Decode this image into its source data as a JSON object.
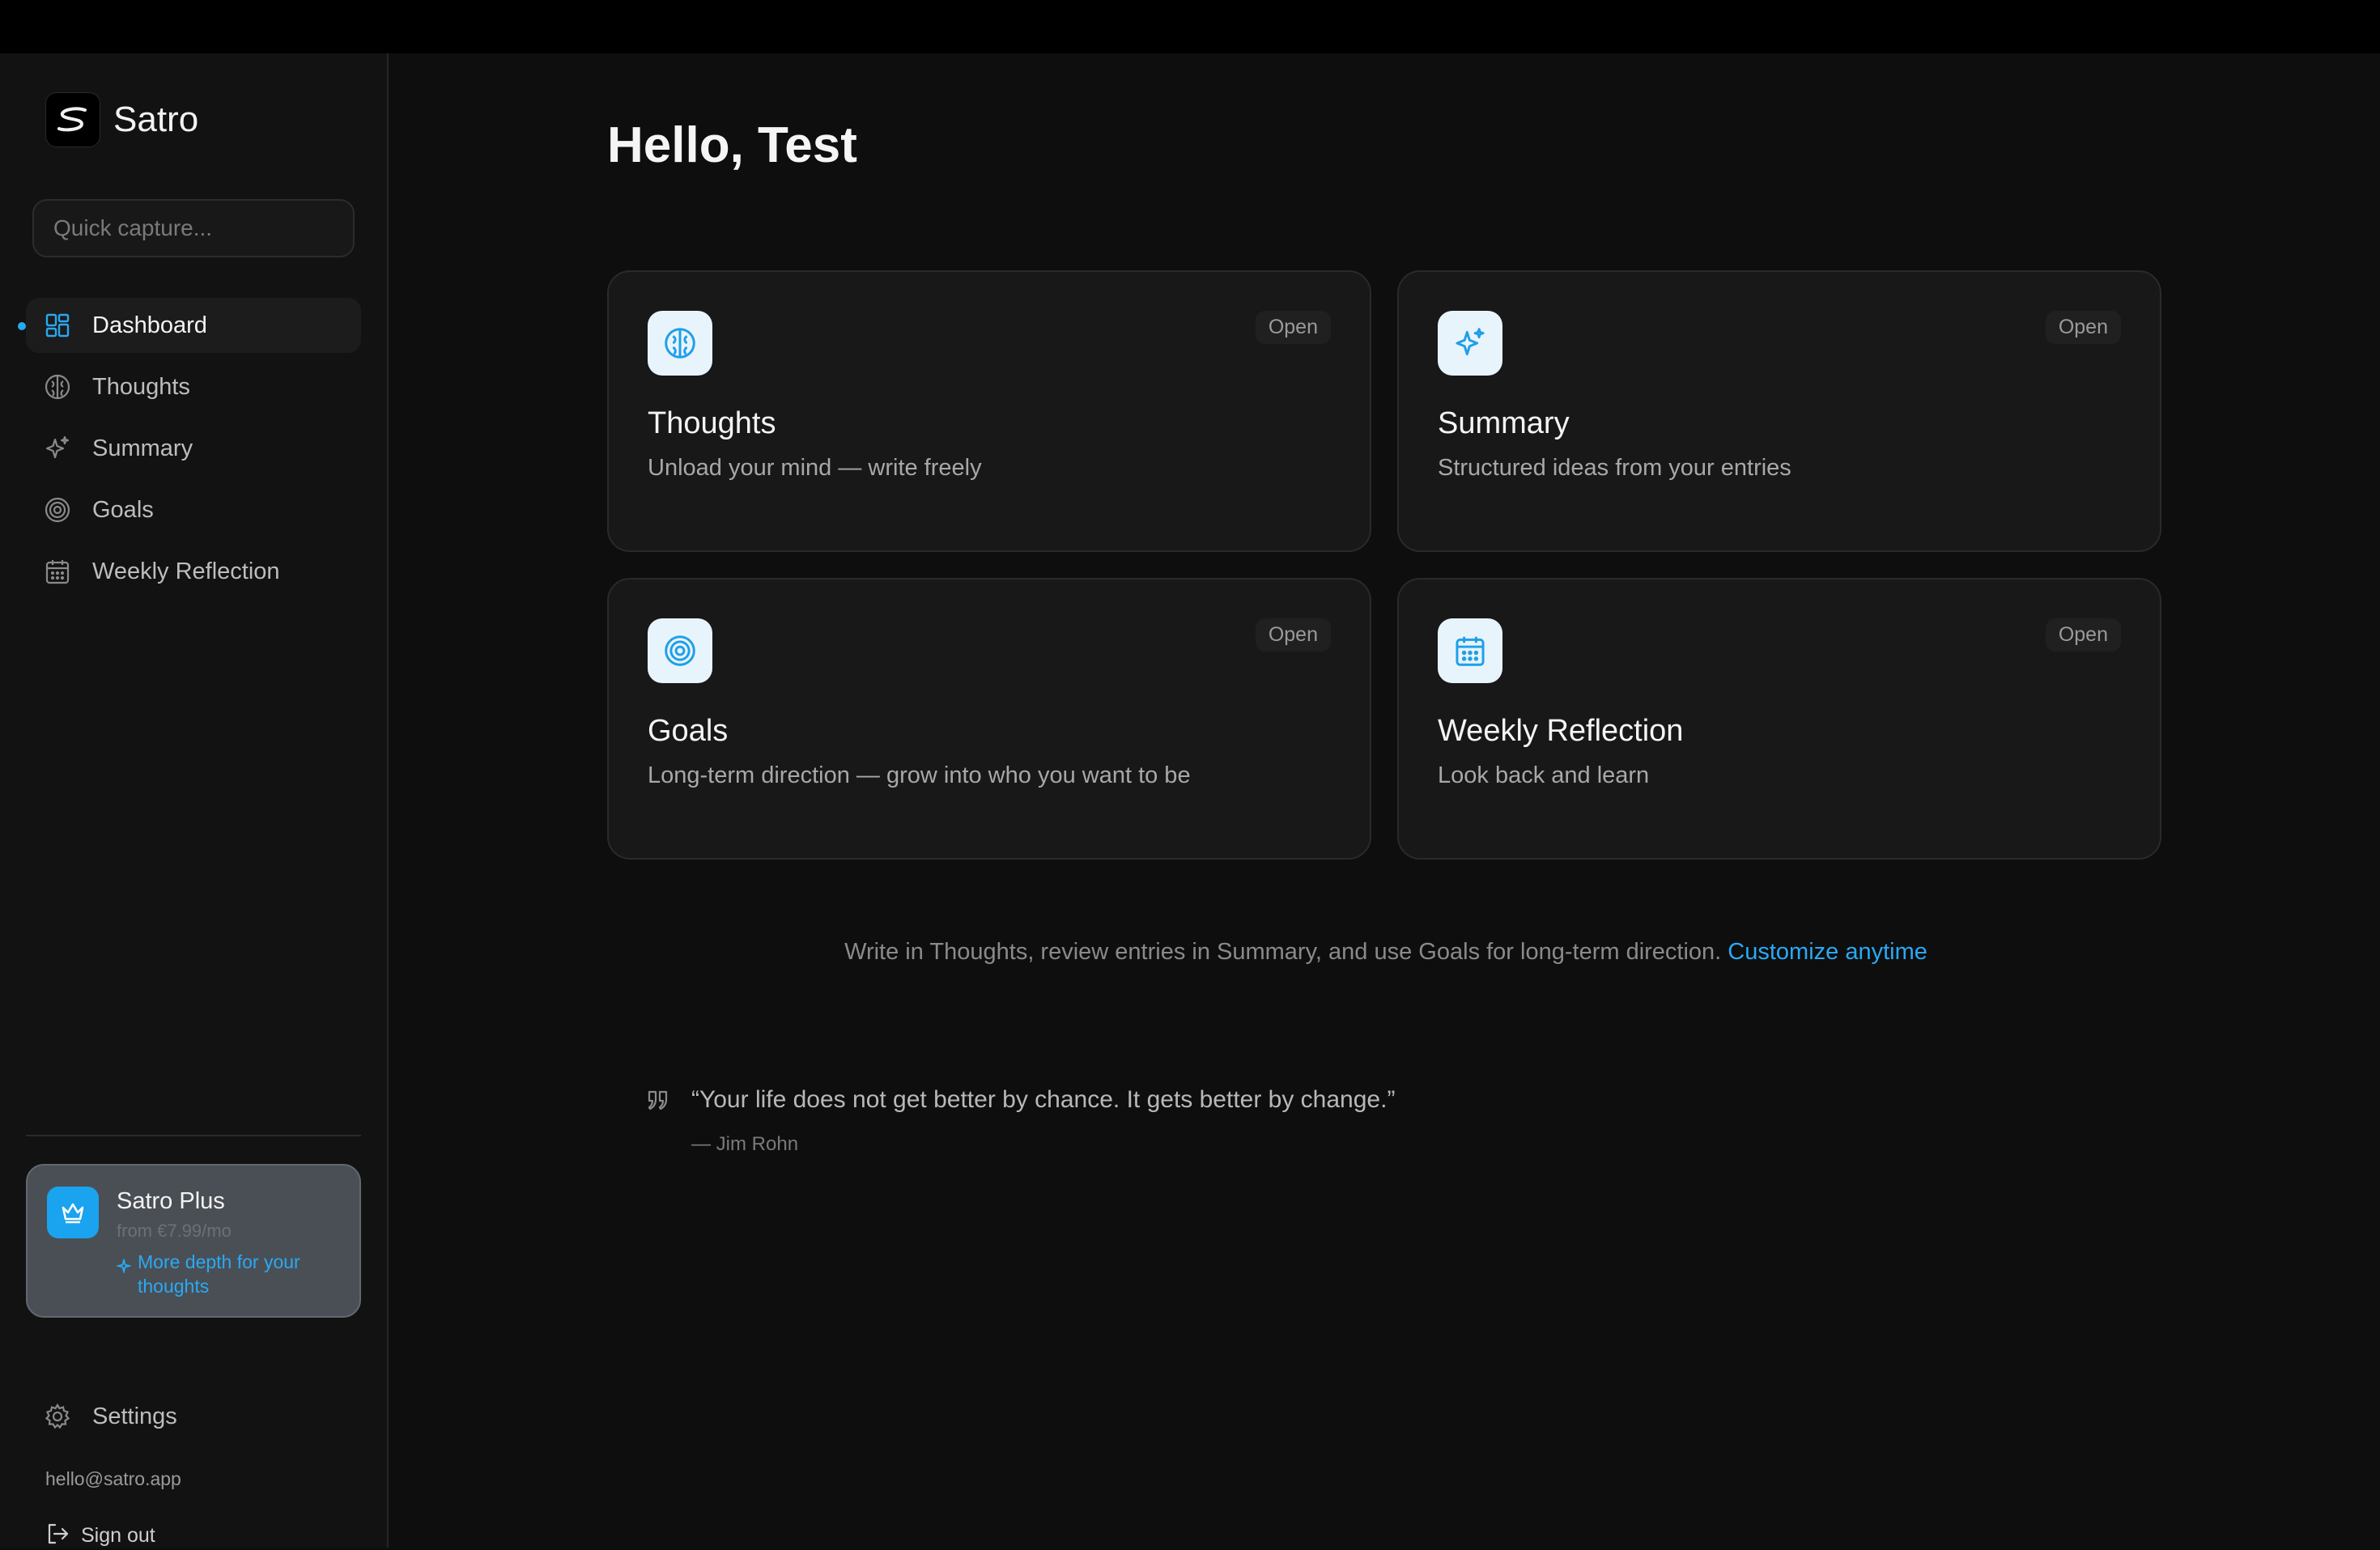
{
  "app": {
    "name": "Satro"
  },
  "sidebar": {
    "quick_capture_placeholder": "Quick capture...",
    "nav": [
      {
        "label": "Dashboard",
        "icon": "dashboard-icon",
        "active": true
      },
      {
        "label": "Thoughts",
        "icon": "brain-icon",
        "active": false
      },
      {
        "label": "Summary",
        "icon": "sparkles-icon",
        "active": false
      },
      {
        "label": "Goals",
        "icon": "target-icon",
        "active": false
      },
      {
        "label": "Weekly Reflection",
        "icon": "calendar-icon",
        "active": false
      }
    ],
    "plus": {
      "title": "Satro Plus",
      "price": "from €7.99/mo",
      "tagline": "More depth for your thoughts"
    },
    "settings_label": "Settings",
    "email": "hello@satro.app",
    "signout_label": "Sign out"
  },
  "main": {
    "greeting": "Hello, Test",
    "cards": [
      {
        "title": "Thoughts",
        "description": "Unload your mind — write freely",
        "badge": "Open",
        "icon": "brain-icon"
      },
      {
        "title": "Summary",
        "description": "Structured ideas from your entries",
        "badge": "Open",
        "icon": "sparkles-icon"
      },
      {
        "title": "Goals",
        "description": "Long-term direction — grow into who you want to be",
        "badge": "Open",
        "icon": "target-icon"
      },
      {
        "title": "Weekly Reflection",
        "description": "Look back and learn",
        "badge": "Open",
        "icon": "calendar-icon"
      }
    ],
    "hint_text": "Write in Thoughts, review entries in Summary, and use Goals for long-term direction.",
    "hint_link": "Customize anytime",
    "quote": {
      "text": "“Your life does not get better by chance. It gets better by change.”",
      "author": "— Jim Rohn"
    }
  },
  "colors": {
    "accent": "#28a8f2",
    "background": "#0e0e0e",
    "sidebar": "#121212",
    "card": "#181818"
  }
}
